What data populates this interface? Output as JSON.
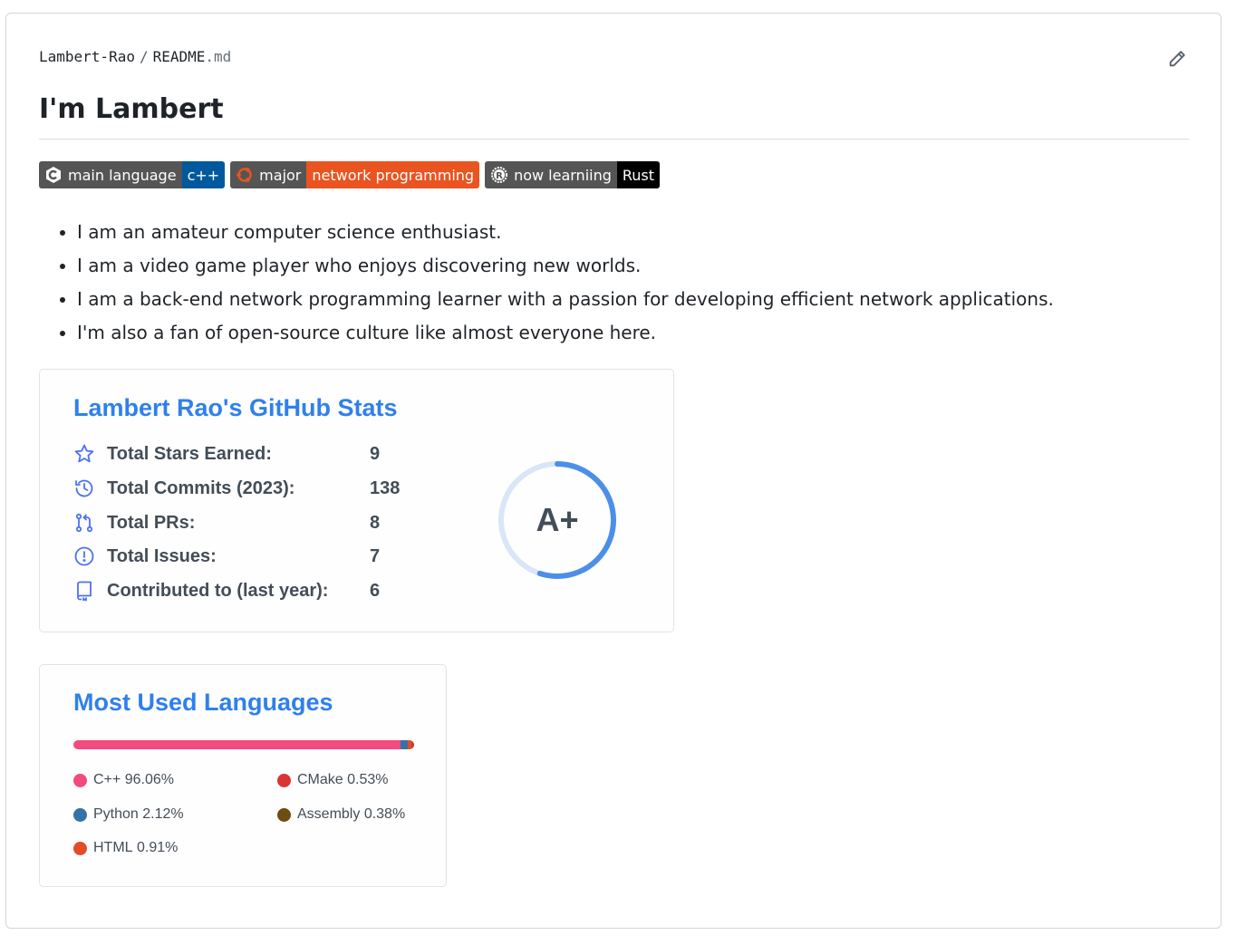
{
  "file": {
    "owner": "Lambert-Rao",
    "separator": "/",
    "name": "README",
    "ext": ".md"
  },
  "title": "I'm Lambert",
  "badges": [
    {
      "label": "main language",
      "value": "c++",
      "icon": "cplusplus-icon",
      "color": "#00599c"
    },
    {
      "label": "major",
      "value": "network programming",
      "icon": "ubuntu-icon",
      "color": "#e95420"
    },
    {
      "label": "now learniing",
      "value": "Rust",
      "icon": "rust-icon",
      "color": "#000000"
    }
  ],
  "bullets": [
    "I am an amateur computer science enthusiast.",
    "I am a video game player who enjoys discovering new worlds.",
    "I am a back-end network programming learner with a passion for developing efficient network applications.",
    "I'm also a fan of open-source culture like almost everyone here."
  ],
  "stats": {
    "title": "Lambert Rao's GitHub Stats",
    "rows": [
      {
        "label": "Total Stars Earned:",
        "value": "9",
        "icon": "star-icon"
      },
      {
        "label": "Total Commits (2023):",
        "value": "138",
        "icon": "history-icon"
      },
      {
        "label": "Total PRs:",
        "value": "8",
        "icon": "pull-request-icon"
      },
      {
        "label": "Total Issues:",
        "value": "7",
        "icon": "issue-icon"
      },
      {
        "label": "Contributed to (last year):",
        "value": "6",
        "icon": "repo-icon"
      }
    ],
    "rank": "A+",
    "rank_progress": 0.55,
    "accent": "#2f80ed",
    "ring_color": "#4c8fe8",
    "ring_bg": "#d9e6f8"
  },
  "languages": {
    "title": "Most Used Languages",
    "items": [
      {
        "name": "C++",
        "percent": "96.06%",
        "value": 96.06,
        "color": "#f34b7d"
      },
      {
        "name": "CMake",
        "percent": "0.53%",
        "value": 0.53,
        "color": "#da3434"
      },
      {
        "name": "Python",
        "percent": "2.12%",
        "value": 2.12,
        "color": "#3572a5"
      },
      {
        "name": "Assembly",
        "percent": "0.38%",
        "value": 0.38,
        "color": "#6e4c13"
      },
      {
        "name": "HTML",
        "percent": "0.91%",
        "value": 0.91,
        "color": "#e34c26"
      }
    ]
  }
}
